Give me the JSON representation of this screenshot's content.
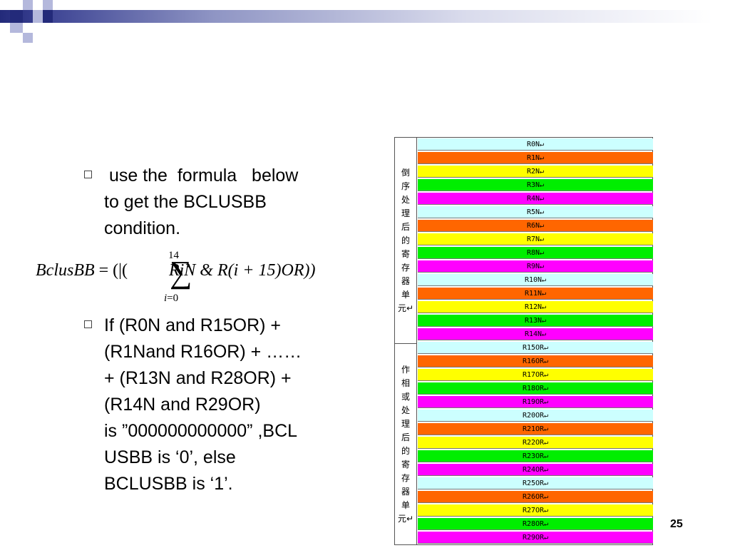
{
  "bullets": [
    {
      "text": " use the  formula   below to get the BCLUSBB condition."
    },
    {
      "text": "If (R0N and R15OR) + (R1Nand R16OR) + …… + (R13N and R28OR) + (R14N and R29OR) is ”000000000000” ,BCL USBB is ‘’, else BCLUSBB is ‘’."
    }
  ],
  "bullet2_lines": [
    "If (R0N and R15OR) +",
    "(R1Nand R16OR) + ……",
    "+ (R13N and R28OR) +",
    "(R14N and R29OR)",
    "is ”000000000000” ,BCL",
    "USBB is ‘0’, else",
    "BCLUSBB is ‘1’."
  ],
  "bullet1_lines": [
    " use the  formula   below",
    "to get the BCLUSBB",
    "condition."
  ],
  "formula": {
    "lhs": "BclusBB",
    "eq": "= (|(",
    "upper": "14",
    "lower_var": "i",
    "lower_rest": "=0",
    "body": "RiN & R(i + 15)OR))"
  },
  "table": {
    "group1_label": [
      "倒",
      "序",
      "处",
      "理",
      "后",
      "的",
      "寄",
      "存",
      "器",
      "单",
      "元↵"
    ],
    "group2_label": [
      "作",
      "相",
      "或",
      "处",
      "理",
      "后",
      "的",
      "寄",
      "存",
      "器",
      "单",
      "元↵"
    ],
    "colors": {
      "cyan": "#ccffff",
      "orange": "#ff6600",
      "yellow": "#ffff00",
      "green": "#00ee00",
      "magenta": "#ff00ff"
    },
    "registers": [
      {
        "label": "R0N↵",
        "color": "cyan"
      },
      {
        "label": "R1N↵",
        "color": "orange"
      },
      {
        "label": "R2N↵",
        "color": "yellow"
      },
      {
        "label": "R3N↵",
        "color": "green"
      },
      {
        "label": "R4N↵",
        "color": "magenta"
      },
      {
        "label": "R5N↵",
        "color": "cyan"
      },
      {
        "label": "R6N↵",
        "color": "orange"
      },
      {
        "label": "R7N↵",
        "color": "yellow"
      },
      {
        "label": "R8N↵",
        "color": "green"
      },
      {
        "label": "R9N↵",
        "color": "magenta"
      },
      {
        "label": "R10N↵",
        "color": "cyan"
      },
      {
        "label": "R11N↵",
        "color": "orange"
      },
      {
        "label": "R12N↵",
        "color": "yellow"
      },
      {
        "label": "R13N↵",
        "color": "green"
      },
      {
        "label": "R14N↵",
        "color": "magenta"
      },
      {
        "label": "R15OR↵",
        "color": "cyan"
      },
      {
        "label": "R16OR↵",
        "color": "orange"
      },
      {
        "label": "R17OR↵",
        "color": "yellow"
      },
      {
        "label": "R18OR↵",
        "color": "green"
      },
      {
        "label": "R19OR↵",
        "color": "magenta"
      },
      {
        "label": "R20OR↵",
        "color": "cyan"
      },
      {
        "label": "R21OR↵",
        "color": "orange"
      },
      {
        "label": "R22OR↵",
        "color": "yellow"
      },
      {
        "label": "R23OR↵",
        "color": "green"
      },
      {
        "label": "R24OR↵",
        "color": "magenta"
      },
      {
        "label": "R25OR↵",
        "color": "cyan"
      },
      {
        "label": "R26OR↵",
        "color": "orange"
      },
      {
        "label": "R27OR↵",
        "color": "yellow"
      },
      {
        "label": "R28OR↵",
        "color": "green"
      },
      {
        "label": "R29OR↵",
        "color": "magenta"
      }
    ]
  },
  "page_number": "25"
}
